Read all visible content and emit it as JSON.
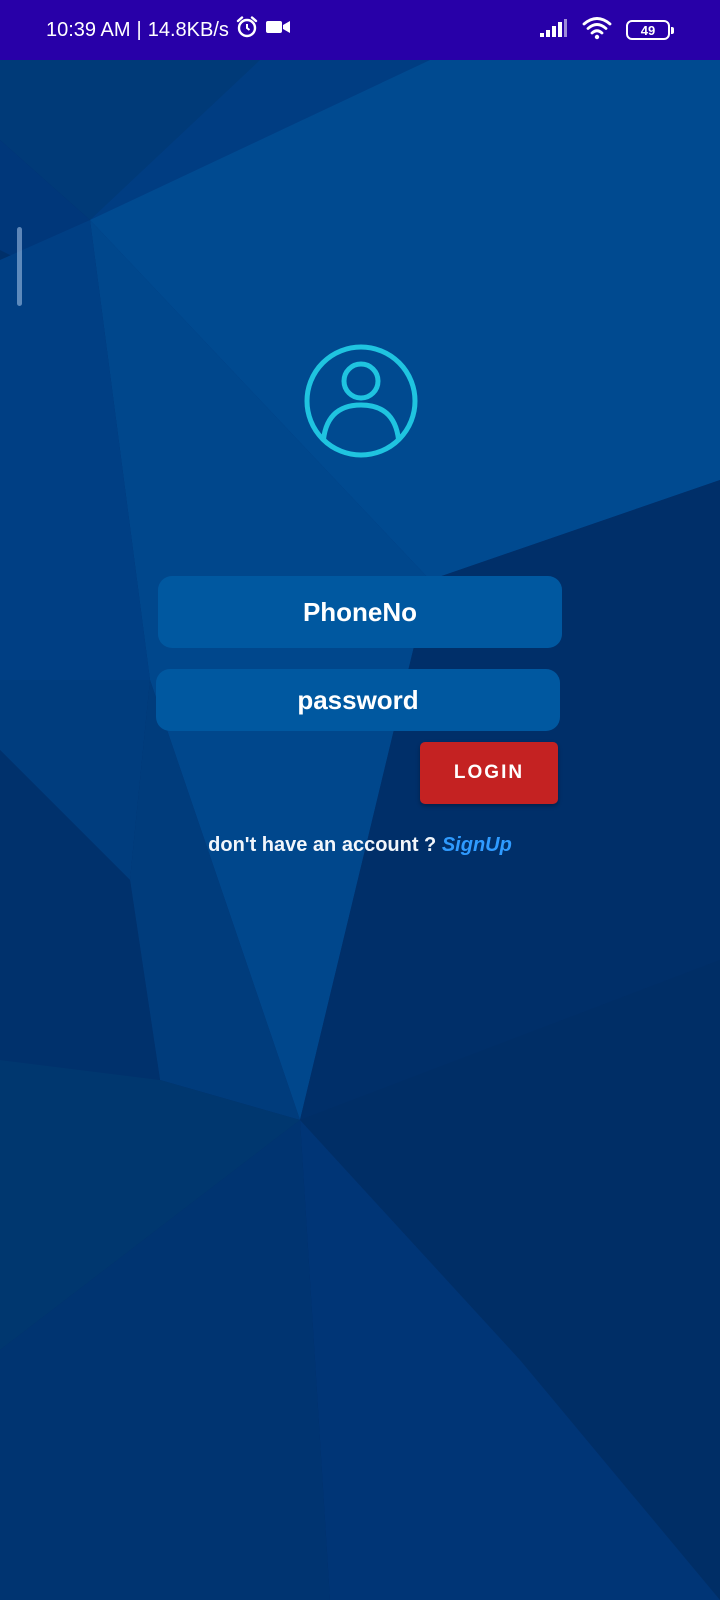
{
  "status_bar": {
    "time": "10:39 AM",
    "separator": "|",
    "network_speed": "14.8KB/s",
    "battery_level": "49",
    "icons": [
      "alarm-icon",
      "video-camera-icon",
      "signal-icon",
      "wifi-icon",
      "battery-icon"
    ]
  },
  "colors": {
    "status_bar": "#2800a8",
    "background": "#00306a",
    "field": "#0058a0",
    "login_button": "#c42222",
    "avatar_ring": "#1fc4e0",
    "signup_link": "#2f9bff"
  },
  "login": {
    "avatar_icon": "user-avatar-icon",
    "phone_placeholder": "PhoneNo",
    "password_placeholder": "password",
    "login_button": "LOGIN",
    "no_account_text": "don't have an account ?",
    "signup_link": "SignUp"
  }
}
